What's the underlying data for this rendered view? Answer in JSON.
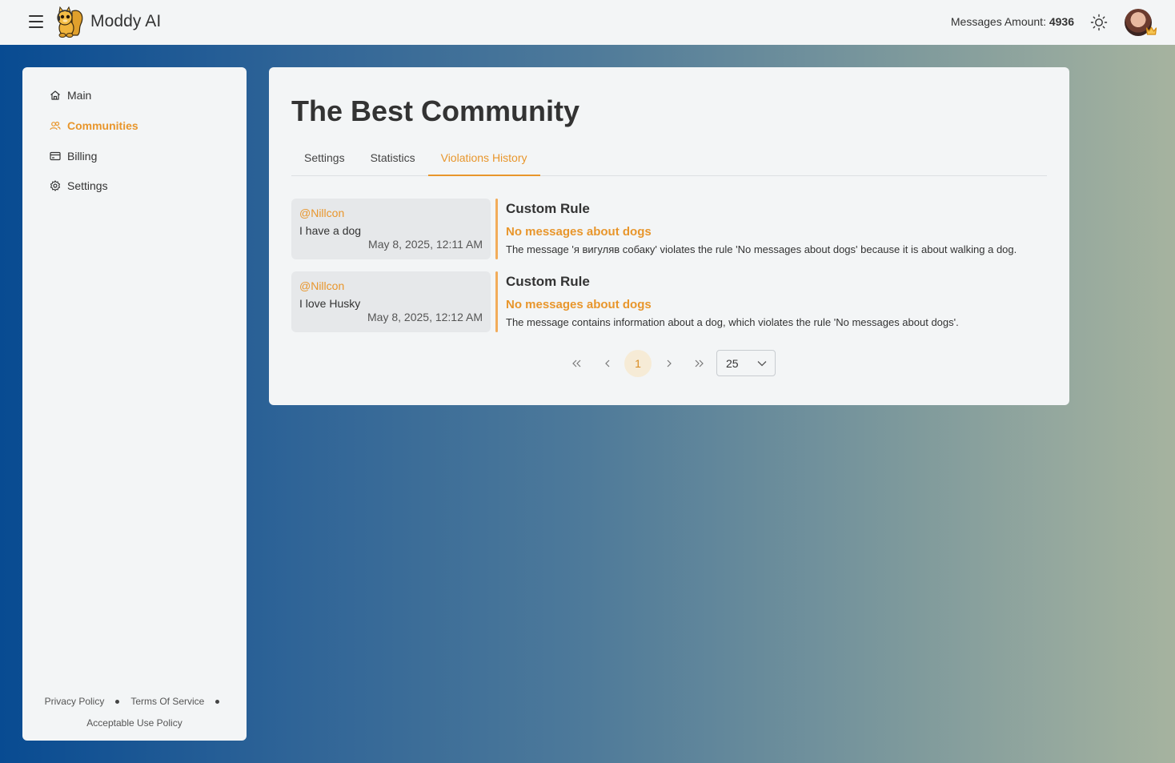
{
  "app": {
    "name": "Moddy AI"
  },
  "header": {
    "messages_label": "Messages Amount:",
    "messages_value": "4936"
  },
  "sidebar": {
    "items": [
      {
        "label": "Main",
        "icon": "home-icon",
        "active": false
      },
      {
        "label": "Communities",
        "icon": "users-icon",
        "active": true
      },
      {
        "label": "Billing",
        "icon": "credit-card-icon",
        "active": false
      },
      {
        "label": "Settings",
        "icon": "gear-icon",
        "active": false
      }
    ],
    "footer": {
      "privacy": "Privacy Policy",
      "terms": "Terms Of Service",
      "aup": "Acceptable Use Policy"
    }
  },
  "main": {
    "title": "The Best Community",
    "tabs": [
      {
        "label": "Settings",
        "active": false
      },
      {
        "label": "Statistics",
        "active": false
      },
      {
        "label": "Violations History",
        "active": true
      }
    ],
    "violations": [
      {
        "user": "@Nillcon",
        "message": "I have a dog",
        "time": "May 8, 2025, 12:11 AM",
        "rule_type": "Custom Rule",
        "rule_name": "No messages about dogs",
        "reason": "The message 'я вигуляв собаку' violates the rule 'No messages about dogs' because it is about walking a dog."
      },
      {
        "user": "@Nillcon",
        "message": "I love Husky",
        "time": "May 8, 2025, 12:12 AM",
        "rule_type": "Custom Rule",
        "rule_name": "No messages about dogs",
        "reason": "The message contains information about a dog, which violates the rule 'No messages about dogs'."
      }
    ],
    "pagination": {
      "current_page": "1",
      "per_page": "25"
    }
  },
  "colors": {
    "accent": "#e8962c",
    "card_bg": "#f3f5f6"
  }
}
